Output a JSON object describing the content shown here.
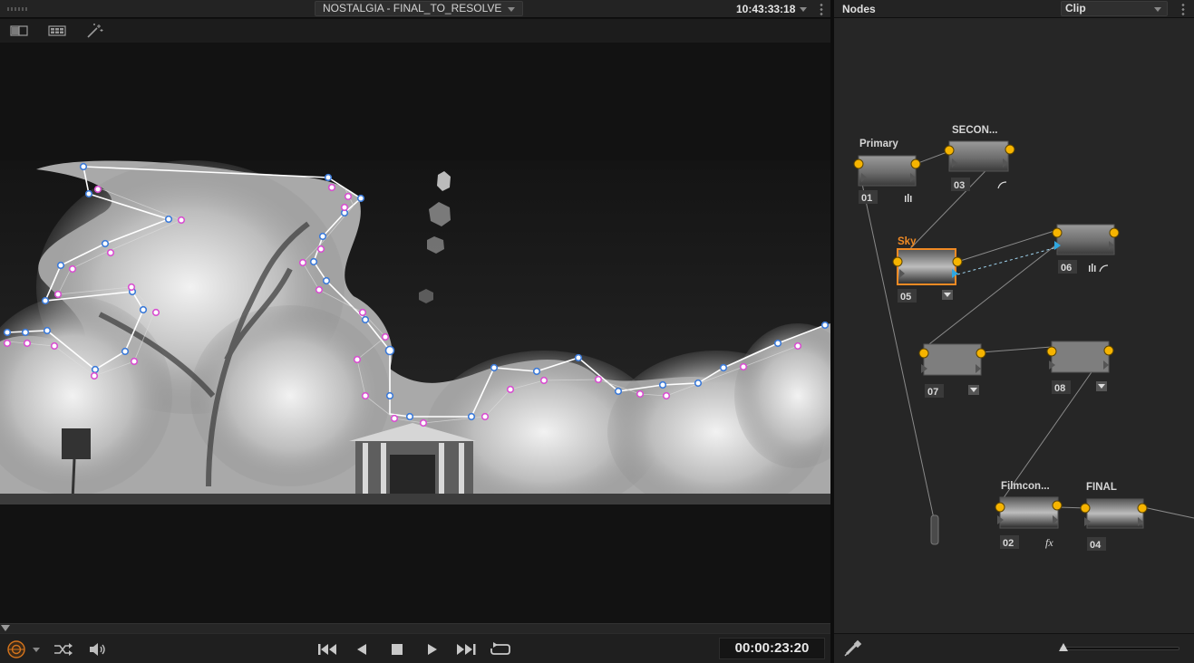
{
  "viewer": {
    "title": "NOSTALGIA -  FINAL_TO_RESOLVE",
    "timecode_top": "10:43:33:18",
    "timecode": "00:00:23:20",
    "toolbar": {
      "icons": [
        "split-screen-icon",
        "gallery-grid-icon",
        "magic-wand-icon"
      ]
    },
    "transport": {
      "icons": [
        "first-frame-icon",
        "reverse-play-icon",
        "stop-icon",
        "play-icon",
        "last-frame-icon",
        "loop-icon"
      ]
    }
  },
  "nodes_panel": {
    "title": "Nodes",
    "mode": "Clip",
    "nodes": [
      {
        "id": "01",
        "label": "Primary"
      },
      {
        "id": "03",
        "label": "SECON..."
      },
      {
        "id": "05",
        "label": "Sky"
      },
      {
        "id": "06",
        "label": ""
      },
      {
        "id": "07",
        "label": ""
      },
      {
        "id": "08",
        "label": ""
      },
      {
        "id": "02",
        "label": "Filmcon..."
      },
      {
        "id": "04",
        "label": "FINAL"
      }
    ],
    "fx_badge": "fx",
    "colors": {
      "selected": "#f08a24",
      "input": "#f6b400",
      "link": "#2fa7e0"
    }
  }
}
